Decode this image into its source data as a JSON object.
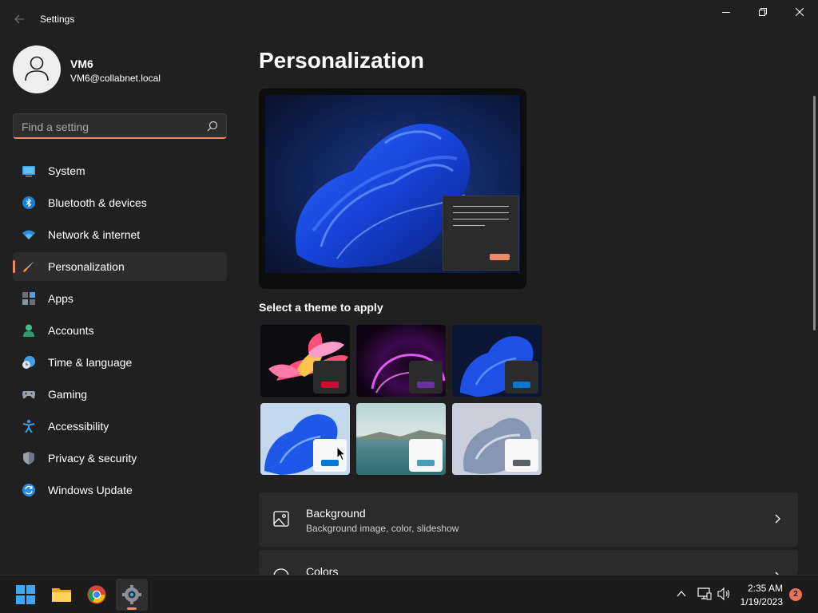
{
  "window": {
    "title": "Settings",
    "back_icon": "arrow-left-icon",
    "controls": [
      "minimize-icon",
      "restore-icon",
      "close-icon"
    ]
  },
  "profile": {
    "name": "VM6",
    "email": "VM6@collabnet.local"
  },
  "search": {
    "placeholder": "Find a setting",
    "value": ""
  },
  "nav": {
    "items": [
      {
        "label": "System",
        "icon": "display-icon"
      },
      {
        "label": "Bluetooth & devices",
        "icon": "bluetooth-icon"
      },
      {
        "label": "Network & internet",
        "icon": "wifi-icon"
      },
      {
        "label": "Personalization",
        "icon": "paintbrush-icon",
        "selected": true
      },
      {
        "label": "Apps",
        "icon": "apps-icon"
      },
      {
        "label": "Accounts",
        "icon": "person-icon"
      },
      {
        "label": "Time & language",
        "icon": "globe-clock-icon"
      },
      {
        "label": "Gaming",
        "icon": "gamepad-icon"
      },
      {
        "label": "Accessibility",
        "icon": "accessibility-icon"
      },
      {
        "label": "Privacy & security",
        "icon": "shield-icon"
      },
      {
        "label": "Windows Update",
        "icon": "update-icon"
      }
    ]
  },
  "main": {
    "title": "Personalization",
    "theme_heading": "Select a theme to apply",
    "themes": [
      {
        "name": "glow-flower",
        "accent": "#c8102e"
      },
      {
        "name": "purple-sunrise",
        "accent": "#6b2fa3"
      },
      {
        "name": "dark-bloom",
        "accent": "#0078d4"
      },
      {
        "name": "light-bloom",
        "accent": "#0078d4"
      },
      {
        "name": "captured-motion",
        "accent": "#4a9db2"
      },
      {
        "name": "flow",
        "accent": "#5b5f66"
      }
    ],
    "cards": [
      {
        "title": "Background",
        "subtitle": "Background image, color, slideshow",
        "icon": "image-icon"
      },
      {
        "title": "Colors",
        "subtitle": "",
        "icon": "palette-icon"
      }
    ]
  },
  "taskbar": {
    "apps": [
      "start-icon",
      "file-explorer-icon",
      "chrome-icon",
      "settings-icon"
    ],
    "tray": [
      "chevron-up-icon",
      "network-icon",
      "volume-icon"
    ],
    "time": "2:35 AM",
    "date": "1/19/2023",
    "notifications": "2"
  },
  "colors": {
    "accent": "#ef8a68",
    "background": "#202020",
    "card": "#2b2b2b"
  }
}
